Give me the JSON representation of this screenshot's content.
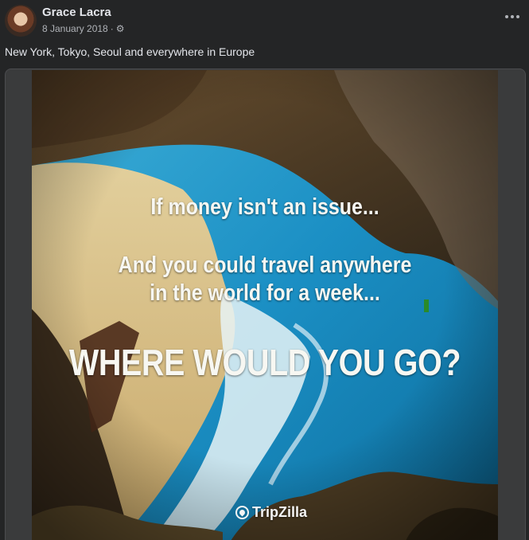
{
  "post": {
    "author": "Grace Lacra",
    "date": "8 January 2018",
    "separator": "·",
    "audience_icon": "gear-icon",
    "more_icon": "more-options-icon",
    "caption": "New York, Tokyo, Seoul and everywhere in Europe"
  },
  "image": {
    "line1": "If money isn't an issue...",
    "line2": "And you could travel anywhere",
    "line3": "in the world for a week...",
    "line4": "WHERE WOULD YOU GO?",
    "brand": "TripZilla",
    "brand_icon": "tripzilla-logo-icon"
  },
  "colors": {
    "background": "#242526",
    "primary_text": "#e4e6eb",
    "secondary_text": "#b0b3b8",
    "sea": "#1b8fc4"
  }
}
